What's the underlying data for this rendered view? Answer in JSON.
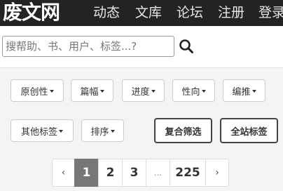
{
  "header": {
    "logo_text": "废文网",
    "nav": [
      "动态",
      "文库",
      "论坛",
      "注册",
      "登录"
    ]
  },
  "search": {
    "placeholder": "搜帮助、书、用户、标签...?",
    "value": "",
    "button_icon": "search-icon"
  },
  "filters": {
    "row1": [
      "原创性",
      "篇幅",
      "进度",
      "性向",
      "编推"
    ],
    "row2": [
      "其他标签",
      "排序"
    ],
    "actions": [
      "复合筛选",
      "全站标签"
    ]
  },
  "pagination": {
    "prev": "‹",
    "pages": [
      "1",
      "2",
      "3"
    ],
    "ellipsis": "...",
    "last_page": "225",
    "next": "›",
    "current": "1"
  },
  "colors": {
    "topbar": "#232323",
    "active_page": "#777777",
    "background": "#f4f4f4"
  }
}
